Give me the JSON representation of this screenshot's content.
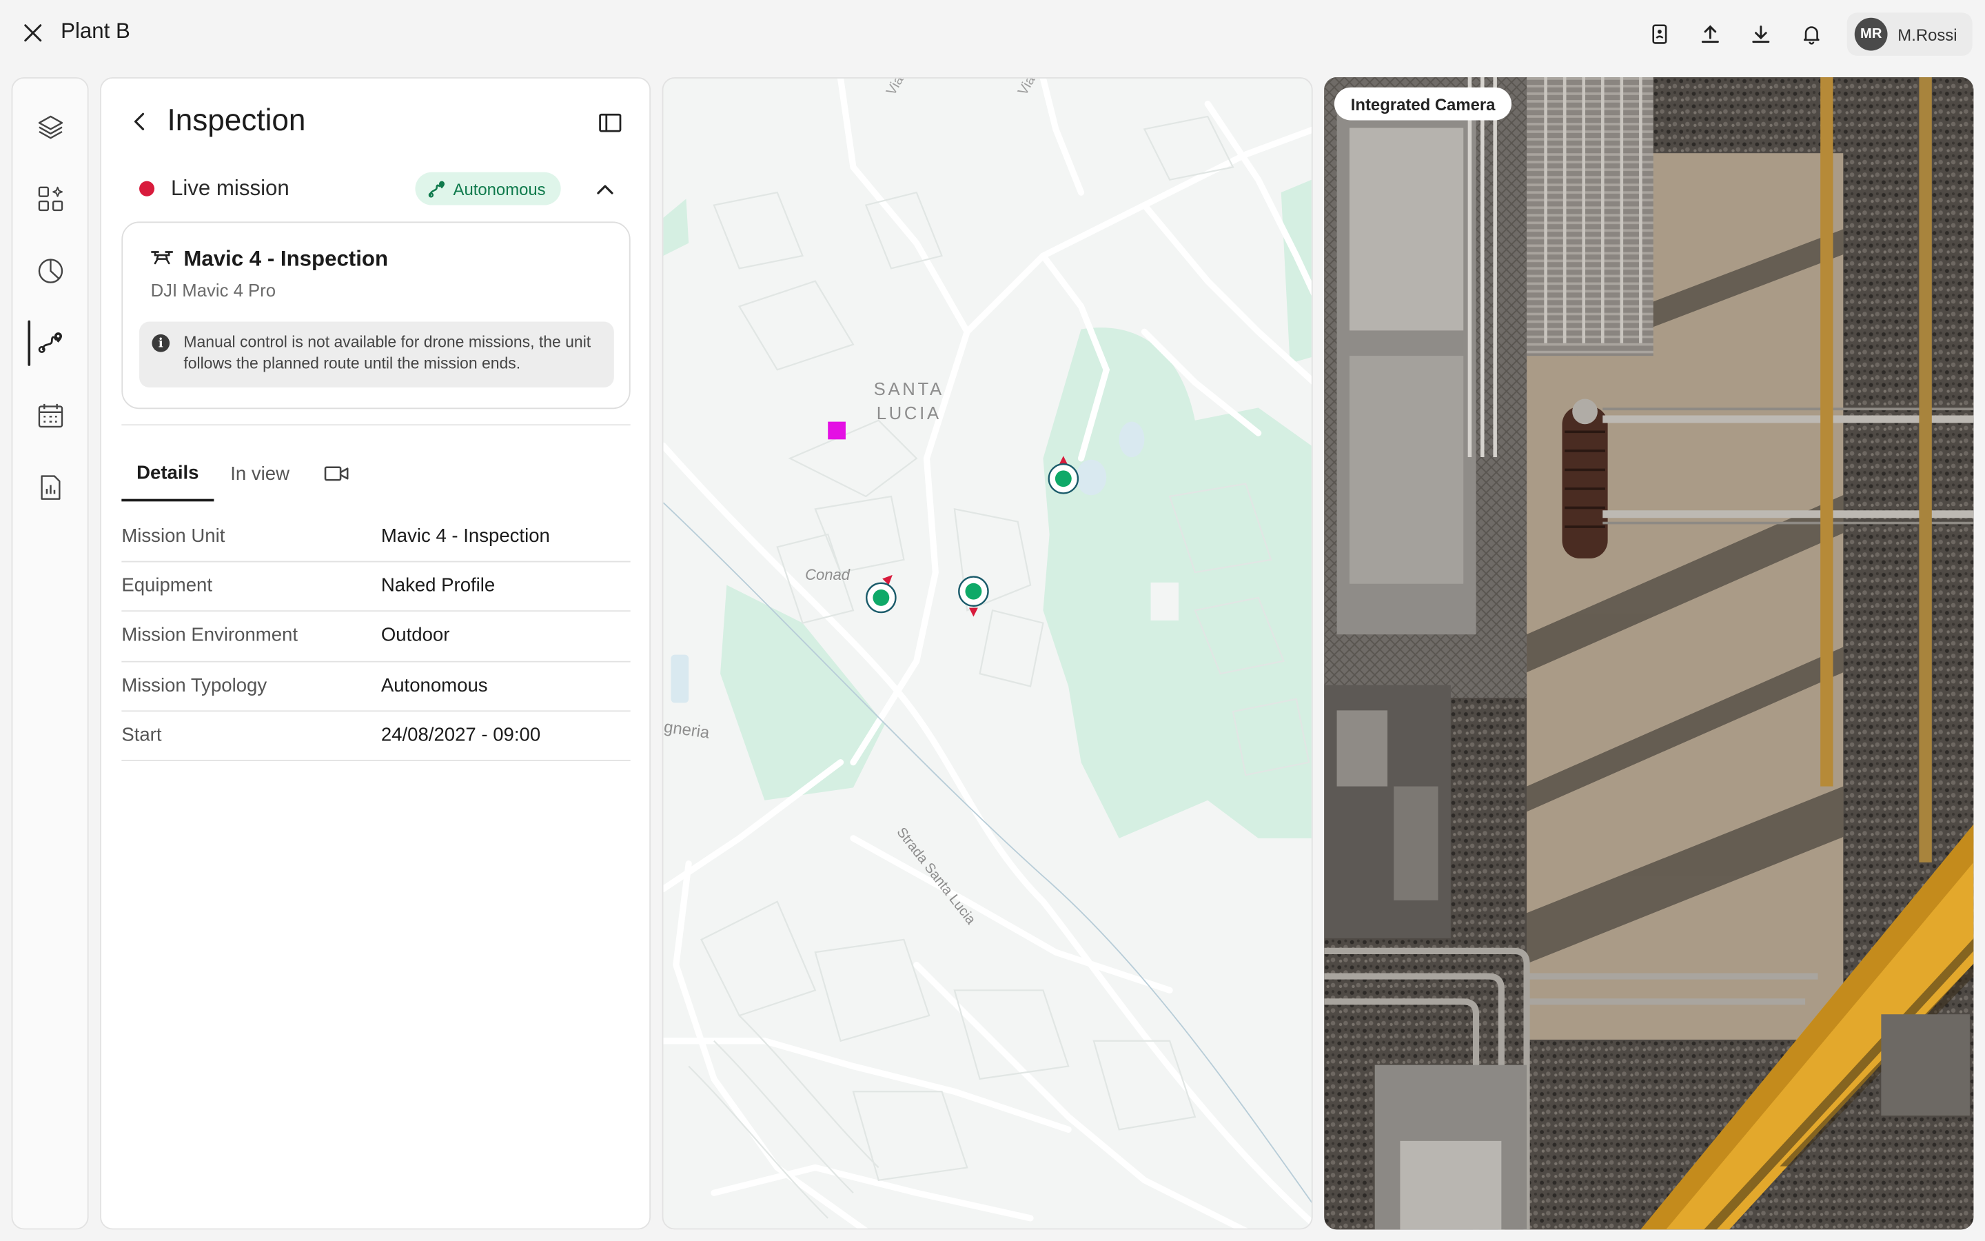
{
  "app": {
    "title": "Plant B"
  },
  "user": {
    "initials": "MR",
    "name": "M.Rossi"
  },
  "topbar_icons": [
    "user-badge-icon",
    "upload-icon",
    "download-icon",
    "bell-icon"
  ],
  "rail": {
    "items": [
      "layers-icon",
      "widgets-icon",
      "analytics-icon",
      "missions-icon",
      "calendar-icon",
      "report-icon"
    ],
    "active": "missions-icon"
  },
  "panel": {
    "title": "Inspection",
    "status": {
      "label": "Live mission",
      "color": "#d81b3c"
    },
    "mode_badge": "Autonomous",
    "unit": {
      "name": "Mavic 4 - Inspection",
      "model": "DJI Mavic 4 Pro",
      "notice": "Manual control is not available for drone missions, the unit follows the planned route until the mission ends."
    },
    "tabs": {
      "details": "Details",
      "in_view": "In view"
    },
    "details": [
      {
        "label": "Mission Unit",
        "value": "Mavic 4 - Inspection"
      },
      {
        "label": "Equipment",
        "value": "Naked Profile"
      },
      {
        "label": "Mission Environment",
        "value": "Outdoor"
      },
      {
        "label": "Mission Typology",
        "value": "Autonomous"
      },
      {
        "label": "Start",
        "value": "24/08/2027 - 09:00"
      }
    ]
  },
  "map": {
    "district_line1": "SANTA",
    "district_line2": "LUCIA",
    "poi": "Conad",
    "street_strada": "Strada Santa Lucia",
    "street_partial": "gneria",
    "street_top1": "Via",
    "street_top2": "Via",
    "marker_color": "#0fa968",
    "heading_color": "#d81b3c",
    "target_color": "#e410e4"
  },
  "camera": {
    "label": "Integrated Camera"
  },
  "colors": {
    "accent_green": "#0f7a4c",
    "badge_bg": "#dff5ea",
    "park_green": "#d5efe2"
  }
}
